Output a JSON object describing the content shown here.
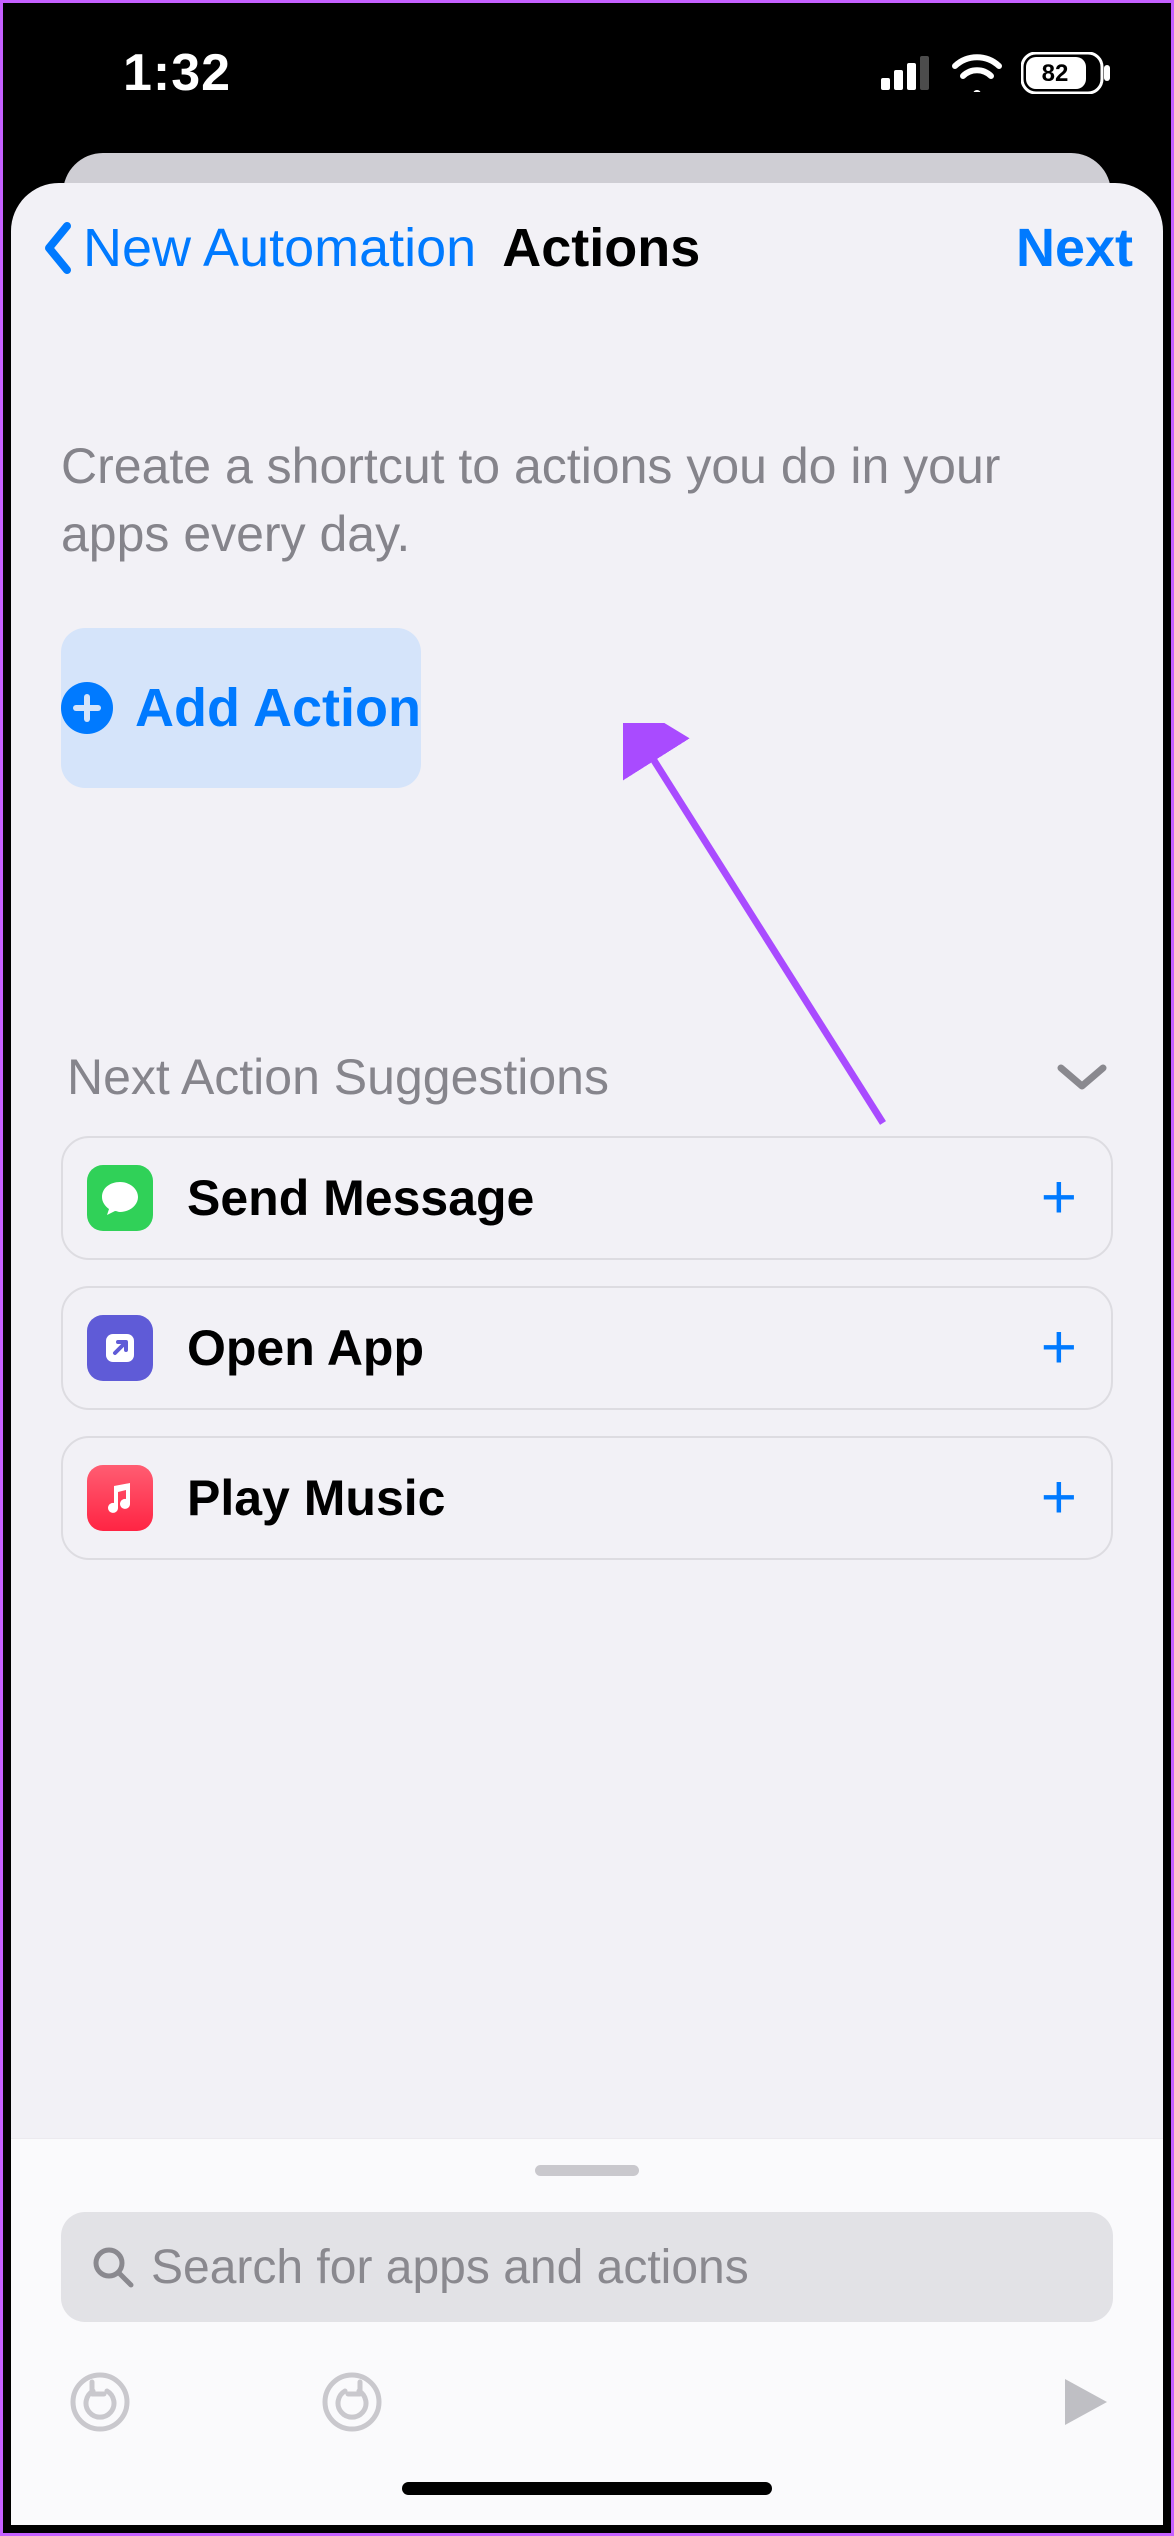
{
  "status_bar": {
    "time": "1:32",
    "battery_pct": "82"
  },
  "nav": {
    "back_label": "New Automation",
    "title": "Actions",
    "next_label": "Next"
  },
  "description": "Create a shortcut to actions you do in your apps every day.",
  "add_action_label": "Add Action",
  "suggestions": {
    "header": "Next Action Suggestions",
    "items": [
      {
        "icon": "messages",
        "label": "Send Message"
      },
      {
        "icon": "open-app",
        "label": "Open App"
      },
      {
        "icon": "music",
        "label": "Play Music"
      }
    ]
  },
  "search": {
    "placeholder": "Search for apps and actions"
  },
  "icon_colors": {
    "messages_bg": "#30d158",
    "openapp_bg": "#5f5bd7",
    "music_bg": "#ff3851"
  }
}
